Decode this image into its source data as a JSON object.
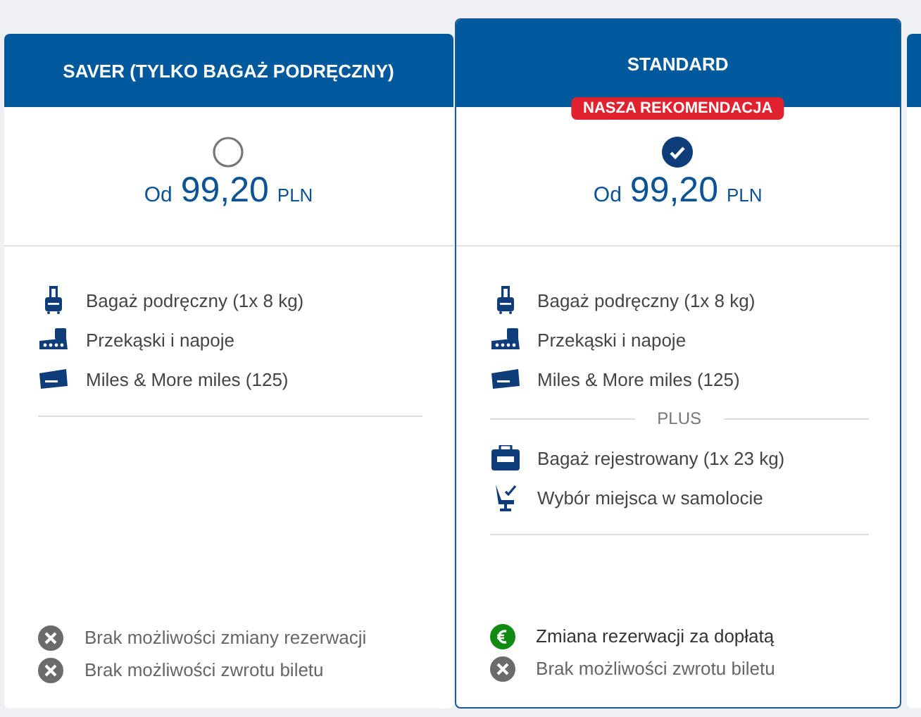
{
  "plans": [
    {
      "title": "SAVER (TYLKO BAGAŻ PODRĘCZNY)",
      "selected": false,
      "price_prefix": "Od",
      "price": "99,20",
      "currency": "PLN",
      "features": [
        {
          "kind": "cabin-bag",
          "text": "Bagaż podręczny (1x 8 kg)"
        },
        {
          "kind": "snacks",
          "text": "Przekąski i napoje"
        },
        {
          "kind": "miles",
          "text": "Miles & More miles (125)"
        }
      ],
      "conditions": [
        {
          "kind": "unavailable",
          "text": "Brak możliwości zmiany rezerwacji"
        },
        {
          "kind": "unavailable",
          "text": "Brak możliwości zwrotu biletu"
        }
      ]
    },
    {
      "title": "STANDARD",
      "selected": true,
      "badge": "NASZA REKOMENDACJA",
      "price_prefix": "Od",
      "price": "99,20",
      "currency": "PLN",
      "features": [
        {
          "kind": "cabin-bag",
          "text": "Bagaż podręczny (1x 8 kg)"
        },
        {
          "kind": "snacks",
          "text": "Przekąski i napoje"
        },
        {
          "kind": "miles",
          "text": "Miles & More miles (125)"
        }
      ],
      "plus_label": "PLUS",
      "plus_features": [
        {
          "kind": "checked-bag",
          "text": "Bagaż rejestrowany (1x 23 kg)"
        },
        {
          "kind": "seat",
          "text": "Wybór miejsca w samolocie"
        }
      ],
      "conditions": [
        {
          "kind": "fee",
          "text": "Zmiana rezerwacji za dopłatą"
        },
        {
          "kind": "unavailable",
          "text": "Brak możliwości zwrotu biletu"
        }
      ]
    }
  ]
}
